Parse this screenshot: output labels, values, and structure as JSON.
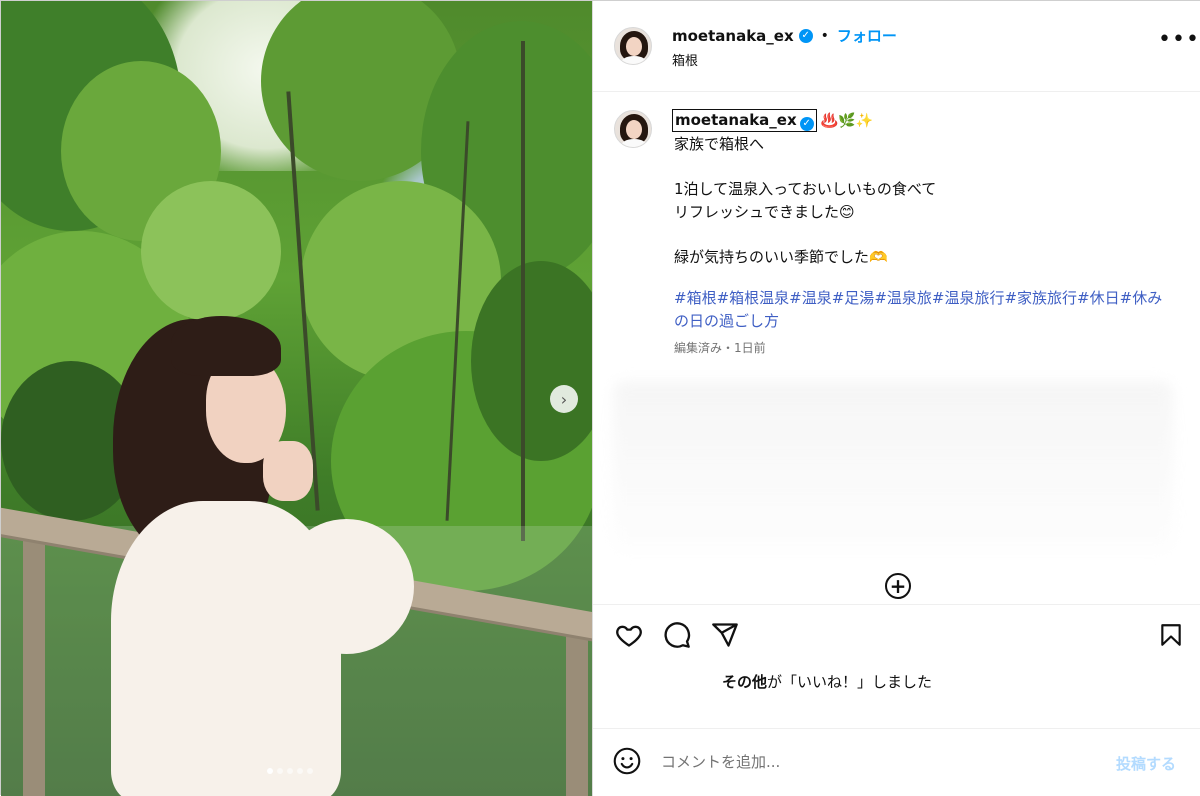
{
  "post": {
    "username": "moetanaka_ex",
    "follow_label": "フォロー",
    "separator": "•",
    "location": "箱根",
    "more_label": "•••",
    "caption_emojis": "♨️🌿✨",
    "caption_text": "家族で箱根へ\n\n1泊して温泉入っておいしいもの食べて\nリフレッシュできました😊\n\n緑が気持ちのいい季節でした🫶",
    "hashtags": [
      "#箱根",
      "#箱根温泉",
      "#温泉",
      "#足湯",
      "#温泉旅",
      "#温泉旅行",
      "#家族旅行",
      "#休日",
      "#休みの日の過ごし方"
    ],
    "meta": "編集済み・1日前",
    "likes_bold": "その他",
    "likes_rest": "が「いいね！」しました",
    "comment_placeholder": "コメントを追加...",
    "post_label": "投稿する",
    "add_label": "+",
    "next_label": "›"
  },
  "carousel": {
    "count": 5,
    "active_index": 0
  },
  "colors": {
    "accent": "#0095f6",
    "hashtag": "#3f5fc4",
    "muted": "#737373"
  },
  "icons": [
    "verified-icon",
    "heart-icon",
    "comment-icon",
    "share-icon",
    "bookmark-icon",
    "emoji-icon",
    "more-icon",
    "add-circle-icon",
    "chevron-right-icon"
  ]
}
